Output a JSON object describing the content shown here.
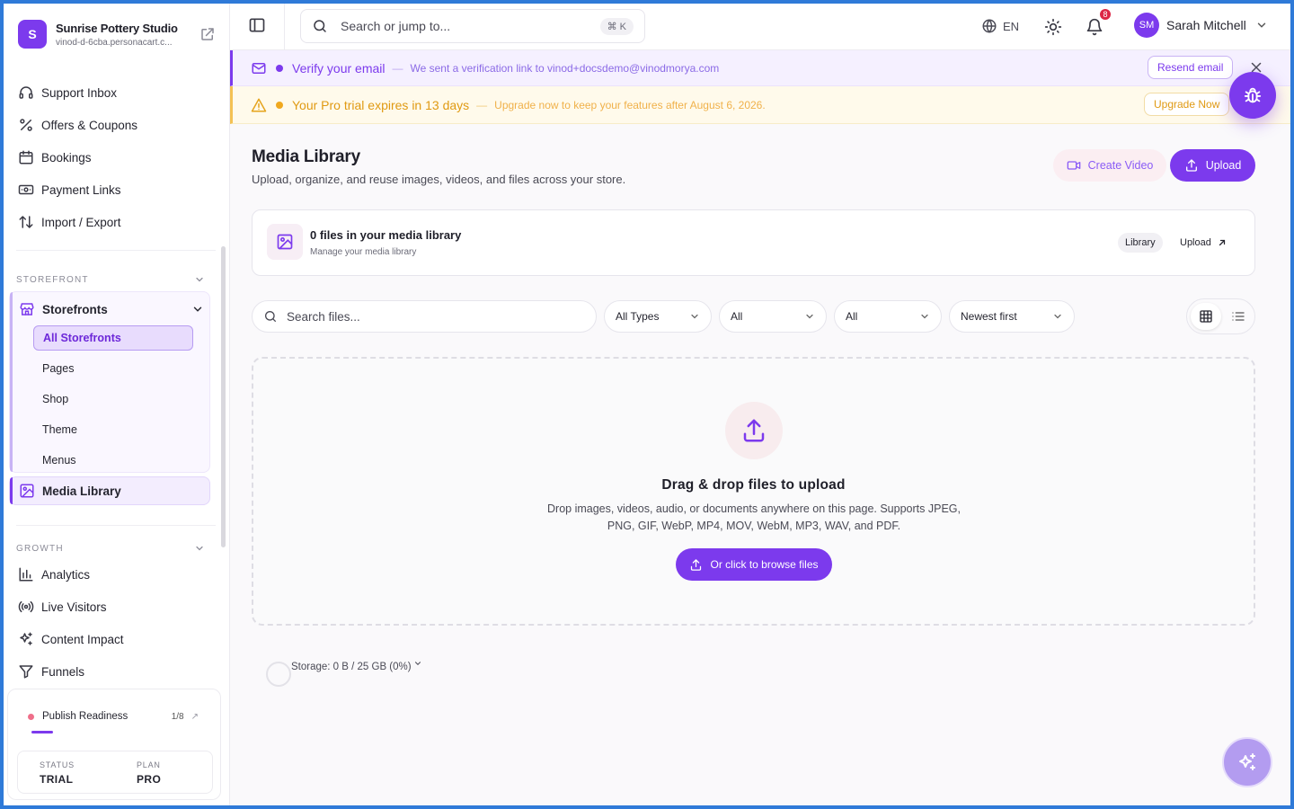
{
  "brand": {
    "initial": "S",
    "name": "Sunrise Pottery Studio",
    "url": "vinod-d-6cba.personacart.c..."
  },
  "sidebar": {
    "top_items": [
      {
        "label": "Support Inbox",
        "icon": "headset-icon"
      },
      {
        "label": "Offers & Coupons",
        "icon": "percent-icon"
      },
      {
        "label": "Bookings",
        "icon": "calendar-icon"
      },
      {
        "label": "Payment Links",
        "icon": "banknote-icon"
      },
      {
        "label": "Import / Export",
        "icon": "arrows-up-down-icon"
      }
    ],
    "storefront_section": "STOREFRONT",
    "storefronts": {
      "label": "Storefronts",
      "sub_items": [
        "All Storefronts",
        "Pages",
        "Shop",
        "Theme",
        "Menus"
      ]
    },
    "media_library": "Media Library",
    "growth_section": "GROWTH",
    "growth_items": [
      {
        "label": "Analytics",
        "icon": "bar-chart-icon"
      },
      {
        "label": "Live Visitors",
        "icon": "radio-icon"
      },
      {
        "label": "Content Impact",
        "icon": "sparkles-icon"
      },
      {
        "label": "Funnels",
        "icon": "funnel-icon"
      }
    ],
    "readiness": {
      "label": "Publish Readiness",
      "count": "1/8",
      "status_label": "STATUS",
      "status_value": "TRIAL",
      "plan_label": "PLAN",
      "plan_value": "PRO"
    }
  },
  "topbar": {
    "search_placeholder": "Search or jump to...",
    "shortcut": "⌘ K",
    "language": "EN",
    "notifications": "8",
    "user_initials": "SM",
    "user_name": "Sarah Mitchell"
  },
  "banners": {
    "verify": {
      "title": "Verify your email",
      "separator": "—",
      "message": "We sent a verification link to vinod+docsdemo@vinodmorya.com",
      "button": "Resend email"
    },
    "trial": {
      "title": "Your Pro trial expires in 13 days",
      "separator": "—",
      "message": "Upgrade now to keep your features after August 6, 2026.",
      "button": "Upgrade Now"
    }
  },
  "page": {
    "title": "Media Library",
    "subtitle": "Upload, organize, and reuse images, videos, and files across your store.",
    "create_video": "Create Video",
    "upload": "Upload"
  },
  "summary": {
    "title": "0 files in your media library",
    "subtitle": "Manage your media library",
    "library_chip": "Library",
    "upload_link": "Upload"
  },
  "filters": {
    "search_placeholder": "Search files...",
    "type": "All Types",
    "filter2": "All",
    "filter3": "All",
    "sort": "Newest first"
  },
  "dropzone": {
    "title": "Drag & drop files to upload",
    "description": "Drop images, videos, audio, or documents anywhere on this page. Supports JPEG, PNG, GIF, WebP, MP4, MOV, WebM, MP3, WAV, and PDF.",
    "button": "Or click to browse files"
  },
  "storage": {
    "text": "Storage: 0 B / 25 GB (0%)"
  },
  "colors": {
    "accent": "#7c3aed",
    "warning": "#f4c153",
    "badge": "#dc2645"
  }
}
